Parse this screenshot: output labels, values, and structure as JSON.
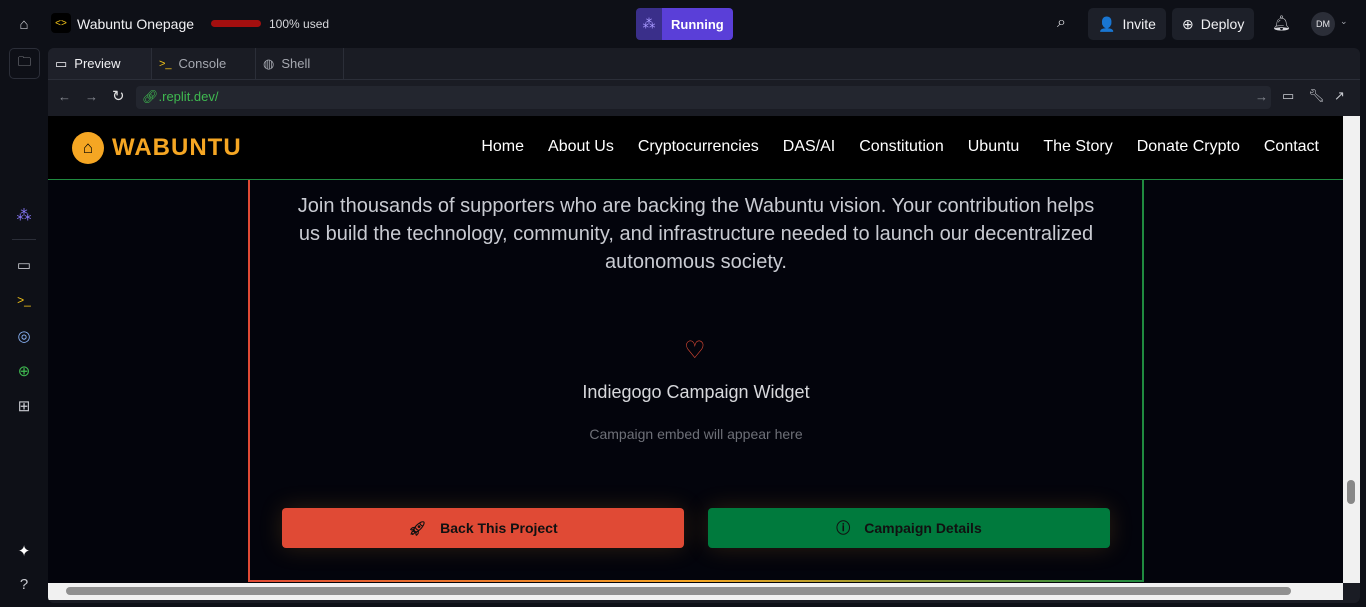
{
  "topbar": {
    "project_name": "Wabuntu Onepage",
    "usage_text": "100% used",
    "usage_fraction": 1.0,
    "run_status": "Running",
    "invite_label": "Invite",
    "deploy_label": "Deploy",
    "avatar_initials": "DM"
  },
  "tabs": [
    {
      "label": "Preview",
      "active": true
    },
    {
      "label": "Console"
    },
    {
      "label": "Shell"
    }
  ],
  "browser": {
    "url": ".replit.dev/"
  },
  "site": {
    "brand": "WABUNTU",
    "nav": [
      "Home",
      "About Us",
      "Cryptocurrencies",
      "DAS/AI",
      "Constitution",
      "Ubuntu",
      "The Story",
      "Donate Crypto",
      "Contact"
    ],
    "intro": "Join thousands of supporters who are backing the Wabuntu vision. Your contribution helps us build the technology, community, and infrastructure needed to launch our decentralized autonomous society.",
    "widget_title": "Indiegogo Campaign Widget",
    "widget_placeholder": "Campaign embed will appear here",
    "back_button": "Back This Project",
    "details_button": "Campaign Details"
  },
  "colors": {
    "accent": "#5a3fd8",
    "brand": "#f5a623",
    "back": "#e04a35",
    "details": "#007a3d",
    "usage": "#a40f0f"
  }
}
